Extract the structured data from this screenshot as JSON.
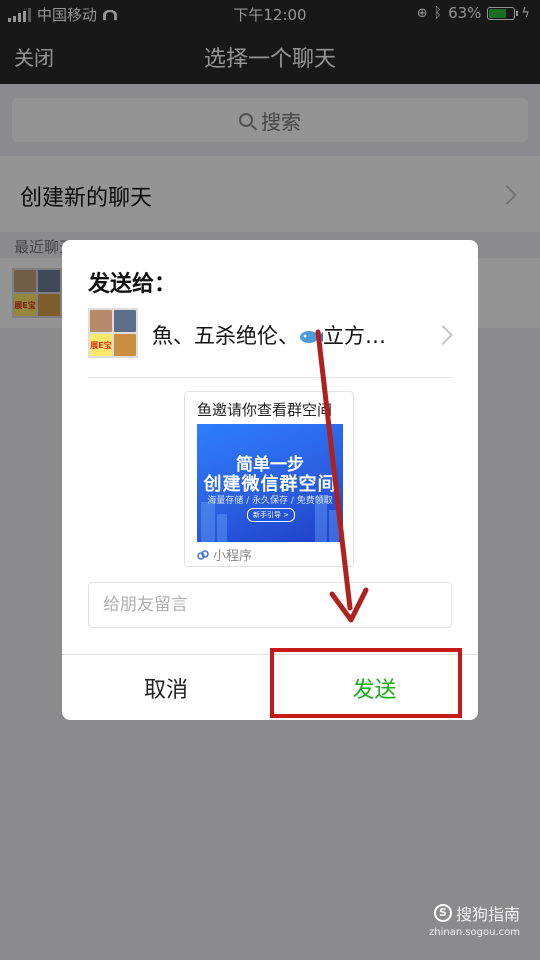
{
  "status_bar": {
    "carrier": "中国移动",
    "time": "下午12:00",
    "battery_percent": "63%",
    "battery_level": 0.63,
    "icons": [
      "signal-icon",
      "wifi-icon",
      "orientation-lock-icon",
      "bluetooth-icon",
      "battery-icon",
      "charging-icon"
    ]
  },
  "nav": {
    "close_label": "关闭",
    "title": "选择一个聊天"
  },
  "search": {
    "placeholder": "搜索"
  },
  "list": {
    "new_chat_label": "创建新的聊天",
    "recent_header": "最近聊天",
    "recent_tile_text": "展E宝"
  },
  "dialog": {
    "title": "发送给：",
    "recipients_text_before": "魚、五杀绝伦、",
    "recipients_text_after": "立方…",
    "card": {
      "title": "鱼邀请你查看群空间",
      "banner_line1": "简单一步",
      "banner_line2": "创建微信群空间",
      "banner_line3": "海量存储 / 永久保存 / 免费领取",
      "banner_button": "新手引导 >",
      "footer_label": "小程序"
    },
    "message_placeholder": "给朋友留言",
    "cancel_label": "取消",
    "send_label": "发送"
  },
  "colors": {
    "accent_green": "#1aad19",
    "annotation_red": "#c41a1a",
    "nav_bg": "#2a2a2a",
    "banner_blue": "#2a5fe0"
  },
  "watermark": {
    "main": "搜狗指南",
    "sub": "zhinan.sogou.com"
  }
}
